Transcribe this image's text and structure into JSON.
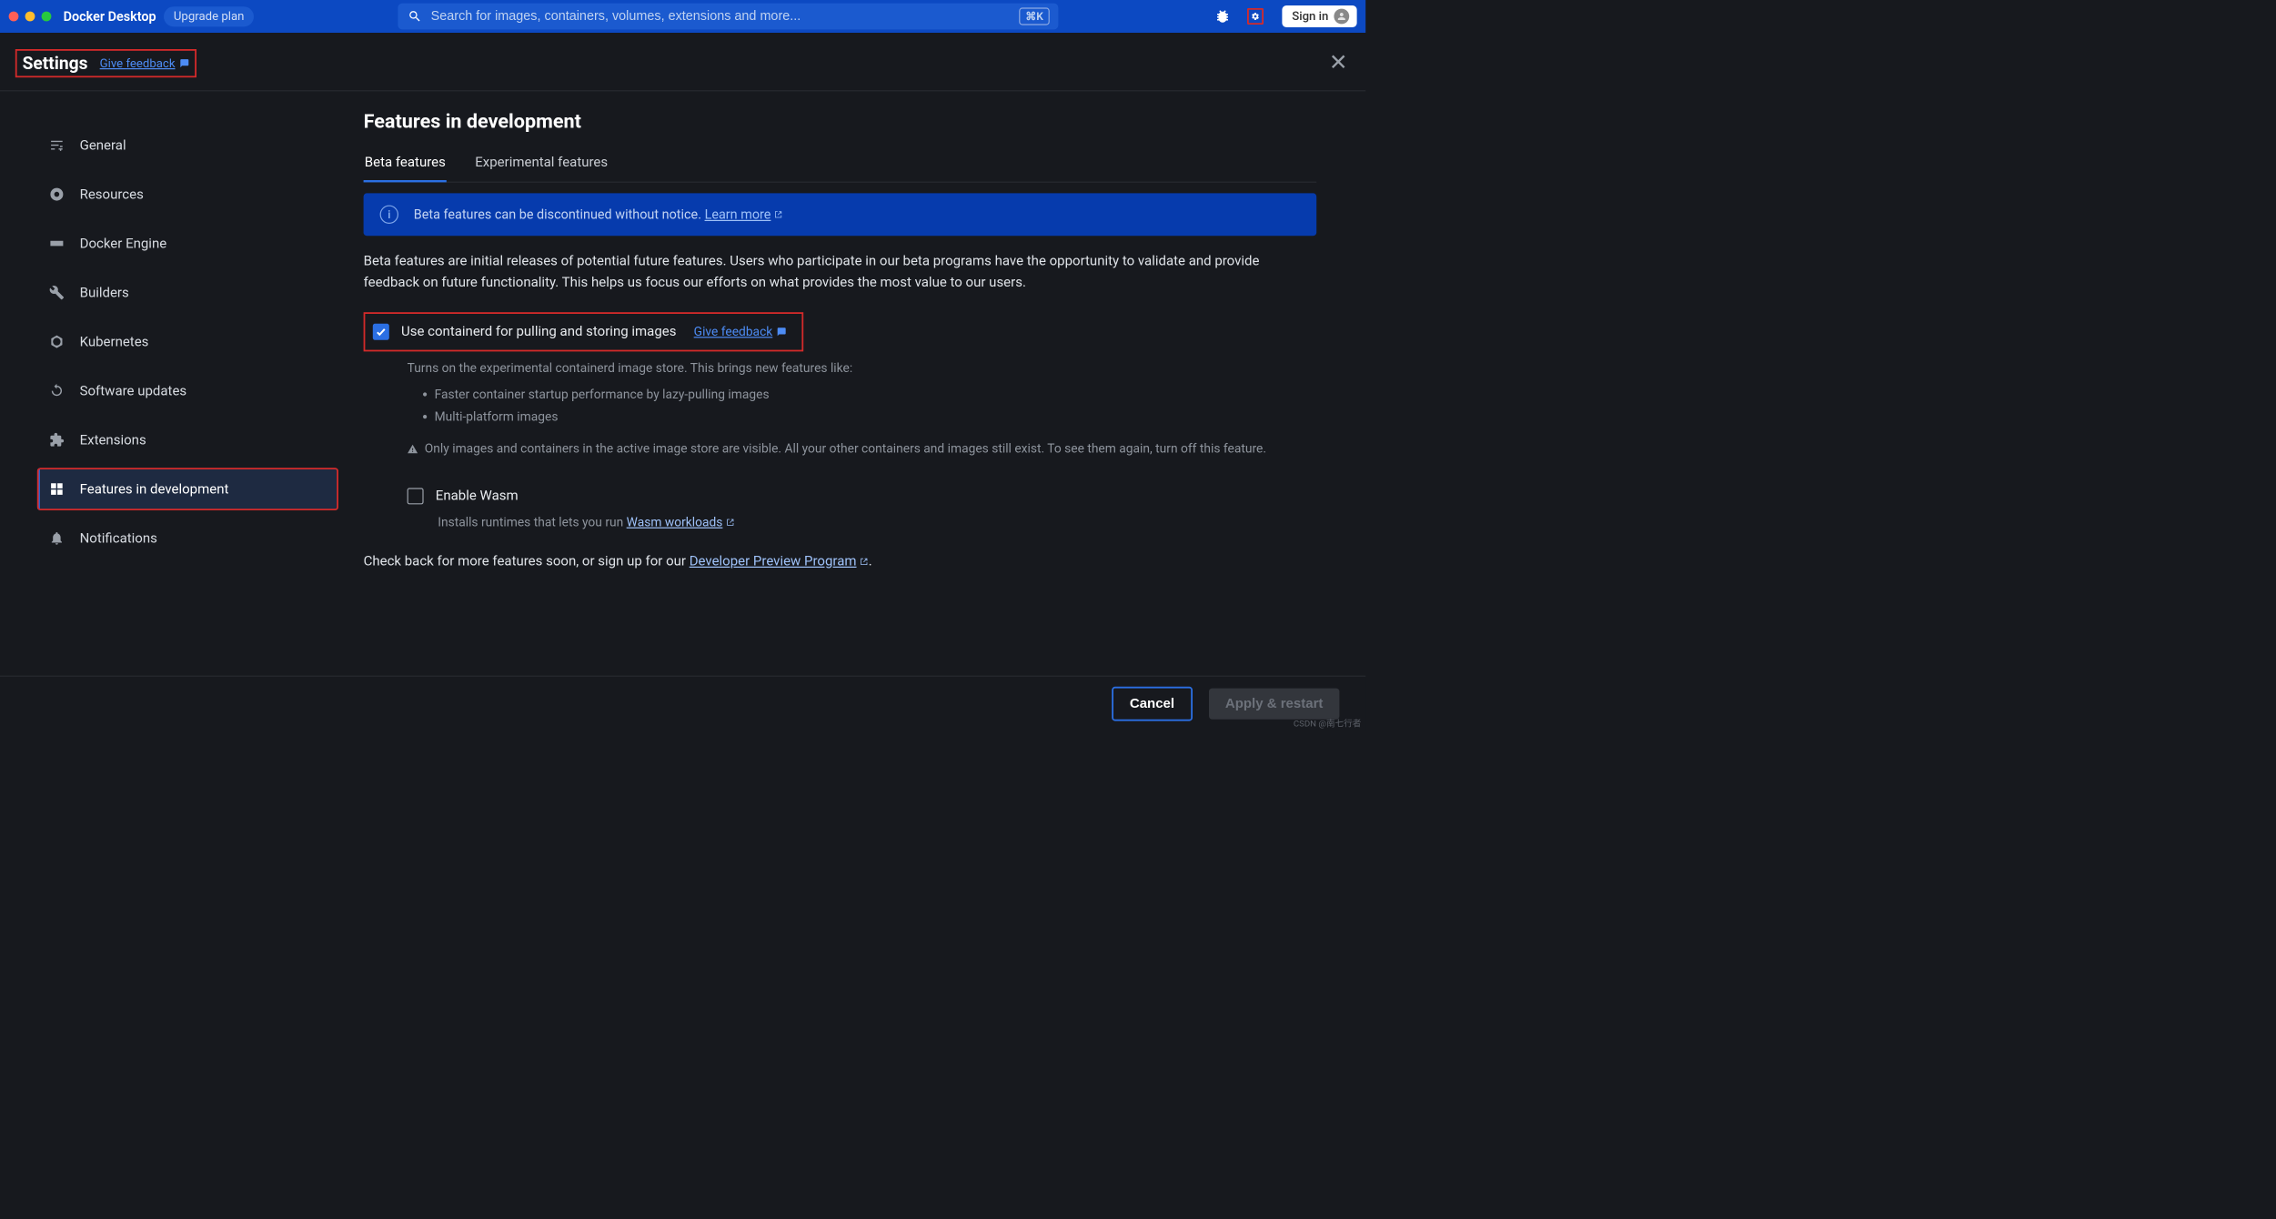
{
  "topbar": {
    "app_title": "Docker Desktop",
    "upgrade_label": "Upgrade plan",
    "search_placeholder": "Search for images, containers, volumes, extensions and more...",
    "kbd_shortcut": "⌘K",
    "signin_label": "Sign in"
  },
  "settings": {
    "title": "Settings",
    "feedback_label": "Give feedback"
  },
  "sidebar": {
    "items": [
      {
        "label": "General"
      },
      {
        "label": "Resources"
      },
      {
        "label": "Docker Engine"
      },
      {
        "label": "Builders"
      },
      {
        "label": "Kubernetes"
      },
      {
        "label": "Software updates"
      },
      {
        "label": "Extensions"
      },
      {
        "label": "Features in development"
      },
      {
        "label": "Notifications"
      }
    ]
  },
  "content": {
    "heading": "Features in development",
    "tabs": {
      "beta": "Beta features",
      "experimental": "Experimental features"
    },
    "banner": {
      "text": "Beta features can be discontinued without notice. ",
      "learn_more": "Learn more"
    },
    "beta_description": "Beta features are initial releases of potential future features. Users who participate in our beta programs have the opportunity to validate and provide feedback on future functionality. This helps us focus our efforts on what provides the most value to our users.",
    "containerd": {
      "label": "Use containerd for pulling and storing images",
      "feedback": "Give feedback",
      "subdesc": "Turns on the experimental containerd image store. This brings new features like:",
      "bullets": [
        "Faster container startup performance by lazy-pulling images",
        "Multi-platform images"
      ],
      "warning": "Only images and containers in the active image store are visible. All your other containers and images still exist. To see them again, turn off this feature."
    },
    "wasm": {
      "label": "Enable Wasm",
      "subdesc_prefix": "Installs runtimes that lets you run ",
      "link": "Wasm workloads"
    },
    "checkback_prefix": "Check back for more features soon, or sign up for our ",
    "checkback_link": "Developer Preview Program"
  },
  "footer": {
    "cancel": "Cancel",
    "apply": "Apply & restart"
  },
  "watermark": "CSDN @南七行者"
}
